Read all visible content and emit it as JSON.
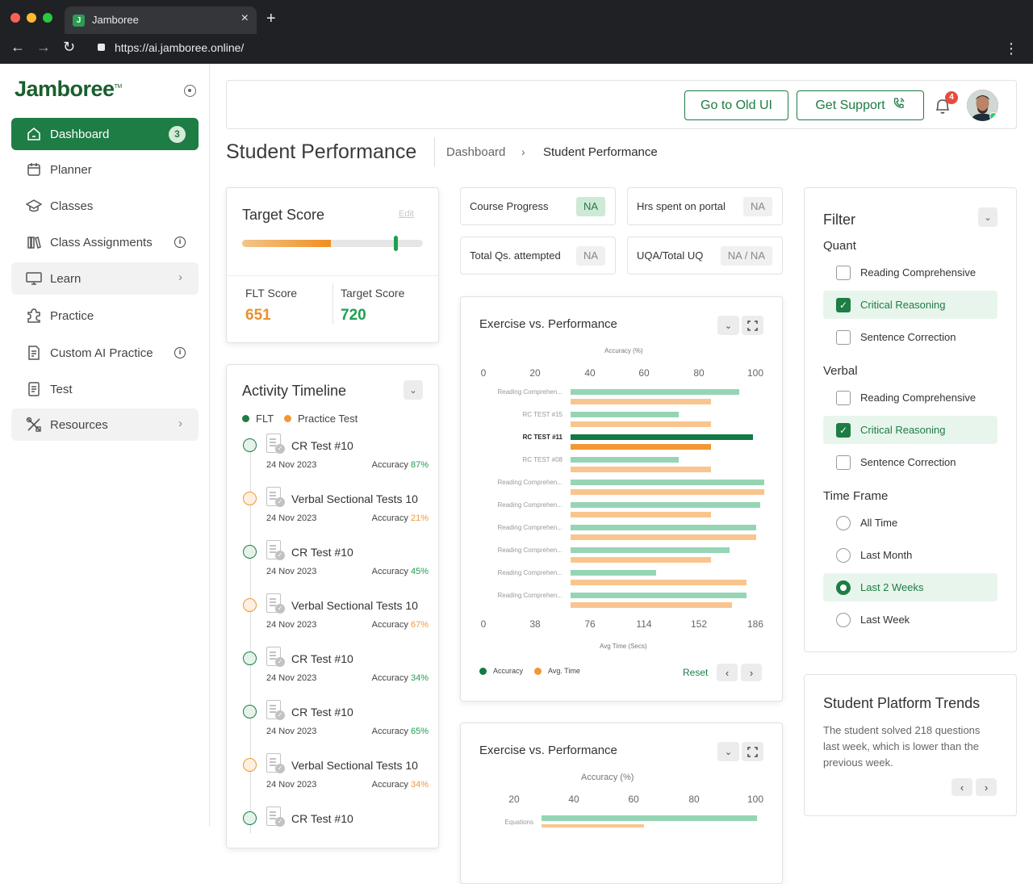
{
  "browser": {
    "tab_title": "Jamboree",
    "url": "https://ai.jamboree.online/"
  },
  "sidebar": {
    "logo": "Jamboree",
    "logo_mark": "TM",
    "items": [
      {
        "label": "Dashboard",
        "badge": "3"
      },
      {
        "label": "Planner"
      },
      {
        "label": "Classes"
      },
      {
        "label": "Class Assignments"
      },
      {
        "label": "Learn"
      },
      {
        "label": "Practice"
      },
      {
        "label": "Custom AI Practice"
      },
      {
        "label": "Test"
      },
      {
        "label": "Resources"
      }
    ]
  },
  "header": {
    "old_ui": "Go to Old UI",
    "support": "Get Support",
    "notifications": "4"
  },
  "page": {
    "title": "Student Performance",
    "crumb_root": "Dashboard",
    "crumb_current": "Student Performance"
  },
  "target_score": {
    "title": "Target Score",
    "edit": "Edit",
    "progress_fill": 0.49,
    "target_marker": 0.85,
    "flt_label": "FLT Score",
    "flt_value": "651",
    "target_label": "Target Score",
    "target_value": "720"
  },
  "stats": [
    {
      "label": "Course Progress",
      "value": "NA"
    },
    {
      "label": "Hrs spent on portal",
      "value": "NA"
    },
    {
      "label": "Total Qs. attempted",
      "value": "NA"
    },
    {
      "label": "UQA/Total UQ",
      "value": "NA / NA"
    }
  ],
  "timeline": {
    "title": "Activity Timeline",
    "legend": [
      "FLT",
      "Practice Test"
    ],
    "items": [
      {
        "name": "CR Test #10",
        "date": "24 Nov 2023",
        "acc_label": "Accuracy",
        "acc": "87%",
        "kind": "flt"
      },
      {
        "name": "Verbal Sectional Tests 10",
        "date": "24 Nov 2023",
        "acc_label": "Accuracy",
        "acc": "21%",
        "kind": "practice"
      },
      {
        "name": "CR Test #10",
        "date": "24 Nov 2023",
        "acc_label": "Accuracy",
        "acc": "45%",
        "kind": "flt"
      },
      {
        "name": "Verbal Sectional Tests 10",
        "date": "24 Nov 2023",
        "acc_label": "Accuracy",
        "acc": "67%",
        "kind": "practice"
      },
      {
        "name": "CR Test #10",
        "date": "24 Nov 2023",
        "acc_label": "Accuracy",
        "acc": "34%",
        "kind": "flt"
      },
      {
        "name": "CR Test #10",
        "date": "24 Nov 2023",
        "acc_label": "Accuracy",
        "acc": "65%",
        "kind": "flt"
      },
      {
        "name": "Verbal Sectional Tests 10",
        "date": "24 Nov 2023",
        "acc_label": "Accuracy",
        "acc": "34%",
        "kind": "practice"
      },
      {
        "name": "CR Test #10",
        "date": "",
        "acc_label": "",
        "acc": "",
        "kind": "flt"
      }
    ]
  },
  "chart_data": [
    {
      "type": "bar",
      "orientation": "horizontal",
      "title": "Exercise vs. Performance",
      "top_axis_label": "Accuracy (%)",
      "top_ticks": [
        "0",
        "20",
        "40",
        "60",
        "80",
        "100"
      ],
      "bottom_axis_label": "Avg Time (Secs)",
      "bottom_ticks": [
        "0",
        "38",
        "76",
        "114",
        "152",
        "186"
      ],
      "categories": [
        "Reading Comprehen...",
        "RC TEST #15",
        "RC TEST #11",
        "RC TEST #08",
        "Reading Comprehen...",
        "Reading Comprehen...",
        "Reading Comprehen...",
        "Reading Comprehen...",
        "Reading Comprehen...",
        "Reading Comprehen..."
      ],
      "highlight_index": 2,
      "series": [
        {
          "name": "Accuracy",
          "axis": "top",
          "values": [
            87,
            56,
            94,
            56,
            100,
            98,
            96,
            82,
            44,
            91
          ]
        },
        {
          "name": "Avg. Time",
          "axis": "bottom",
          "values": [
            135,
            135,
            135,
            135,
            186,
            135,
            178,
            135,
            169,
            155
          ]
        }
      ],
      "xlim_top": [
        0,
        100
      ],
      "xlim_bottom": [
        0,
        186
      ],
      "legend_placement": "bottom-left",
      "reset_label": "Reset"
    },
    {
      "type": "bar",
      "orientation": "horizontal",
      "title": "Exercise vs. Performance",
      "top_axis_label": "Accuracy (%)",
      "top_ticks": [
        "20",
        "40",
        "60",
        "80",
        "100"
      ],
      "categories": [
        "Equations"
      ],
      "series": [
        {
          "name": "Accuracy",
          "values": [
            99
          ]
        },
        {
          "name": "Avg. Time",
          "values": [
            47
          ]
        }
      ]
    }
  ],
  "filter": {
    "title": "Filter",
    "quant": {
      "label": "Quant",
      "options": [
        {
          "label": "Reading Comprehensive",
          "checked": false
        },
        {
          "label": "Critical Reasoning",
          "checked": true
        },
        {
          "label": "Sentence Correction",
          "checked": false
        }
      ]
    },
    "verbal": {
      "label": "Verbal",
      "options": [
        {
          "label": "Reading Comprehensive",
          "checked": false
        },
        {
          "label": "Critical Reasoning",
          "checked": true
        },
        {
          "label": "Sentence Correction",
          "checked": false
        }
      ]
    },
    "timeframe": {
      "label": "Time Frame",
      "options": [
        {
          "label": "All Time",
          "selected": false
        },
        {
          "label": "Last Month",
          "selected": false
        },
        {
          "label": "Last 2 Weeks",
          "selected": true
        },
        {
          "label": "Last Week",
          "selected": false
        }
      ]
    }
  },
  "trends": {
    "title": "Student Platform Trends",
    "text": "The student solved 218 questions last week, which is lower than the previous week."
  },
  "colors": {
    "brand": "#1e7c45",
    "accuracy": "#95d5b5",
    "accuracy_strong": "#137a45",
    "time": "#f9c58f",
    "time_strong": "#f39633",
    "flt": "#1e7c45",
    "practice": "#f39633"
  }
}
